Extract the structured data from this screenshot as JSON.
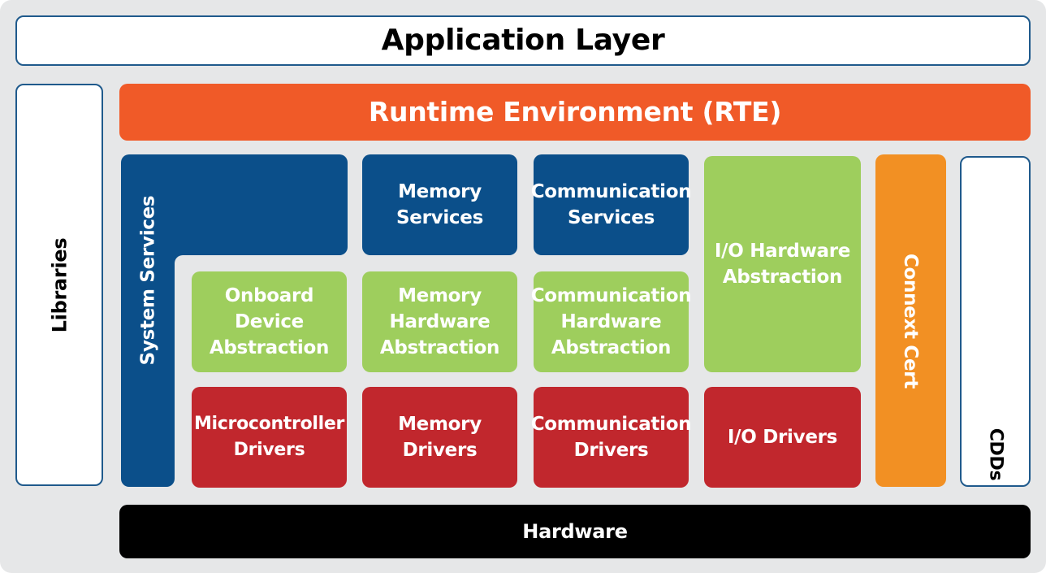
{
  "application_layer": "Application Layer",
  "rte": "Runtime Environment (RTE)",
  "libraries": "Libraries",
  "cdds": "CDDs",
  "system_services": "System Services",
  "memory_services": "Memory\nServices",
  "communication_services": "Communication\nServices",
  "io_hardware_abstraction": "I/O Hardware\nAbstraction",
  "connext_cert": "Connext Cert",
  "onboard_device_abstraction": "Onboard\nDevice\nAbstraction",
  "memory_hardware_abstraction": "Memory\nHardware\nAbstraction",
  "communication_hardware_abstraction": "Communication\nHardware\nAbstraction",
  "microcontroller_drivers": "Microcontroller\nDrivers",
  "memory_drivers": "Memory\nDrivers",
  "communication_drivers": "Communication\nDrivers",
  "io_drivers": "I/O Drivers",
  "hardware": "Hardware",
  "colors": {
    "background": "#e6e7e8",
    "blue": "#0b4f8a",
    "green": "#9ece5d",
    "red": "#c1272d",
    "rte_orange": "#f05a28",
    "connext_orange": "#f29023",
    "hardware_black": "#000000"
  }
}
